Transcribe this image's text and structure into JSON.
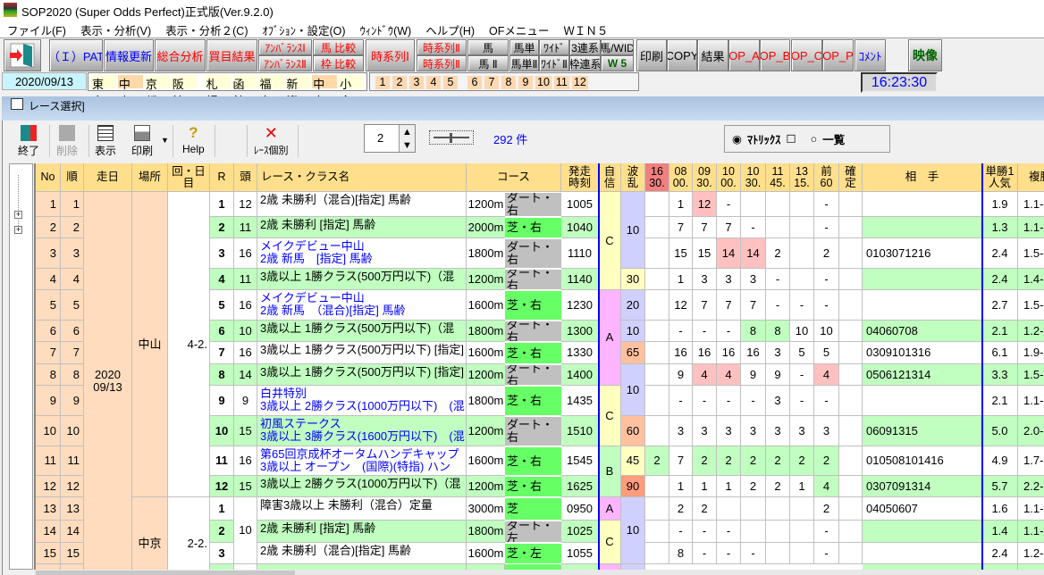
{
  "app": {
    "title": "SOP2020 (Super Odds Perfect)正式版(Ver.9.2.0)"
  },
  "menu": [
    "ファイル(F)",
    "表示・分析(V)",
    "表示・分析２(C)",
    "ｵﾌﾞｼｮﾝ・設定(O)",
    "ｳｨﾝﾄﾞｳ(W)",
    "ヘルプ(H)",
    "OFメニュー",
    "ＷＩＮ５"
  ],
  "toolbar": {
    "pat": "（Ｉ）PAT",
    "update": "情報更新",
    "analysis": "総合分析",
    "results": "買目結果",
    "unbalance1": "ｱﾝﾊﾞﾗﾝｽⅠ",
    "unbalance2": "ｱﾝﾊﾞﾗﾝｽⅡ",
    "horse_cmp": "馬 比較",
    "frame_cmp": "枠 比較",
    "timeseries1": "時系列Ⅰ",
    "timeseries2a": "時系列Ⅱ",
    "timeseries2b": "時系列Ⅱ",
    "horse": "馬",
    "horse2": "馬 Ⅱ",
    "umatan": "馬単",
    "umatan2": "馬単Ⅱ",
    "wide": "ﾜｲﾄﾞ",
    "wide2": "ﾜｲﾄﾞⅡ",
    "trio": "3連系",
    "wakuren": "枠連系",
    "horse_wid": "馬/WID",
    "win5": "W 5",
    "print": "印刷",
    "copy": "COPY",
    "result": "結果",
    "op_a": "OP_A",
    "op_b": "OP_B",
    "op_c": "OP_C",
    "op_p": "OP_P",
    "comment": "ｺﾒﾝﾄ",
    "video": "映像"
  },
  "date": "2020/09/13",
  "places": [
    {
      "name": "東京",
      "active": false
    },
    {
      "name": "中山",
      "active": true
    },
    {
      "name": "京都",
      "active": false
    },
    {
      "name": "阪神",
      "active": false
    },
    {
      "name": "札幌",
      "active": false
    },
    {
      "name": "函館",
      "active": false
    },
    {
      "name": "福島",
      "active": false
    },
    {
      "name": "新潟",
      "active": false
    },
    {
      "name": "中京",
      "active": true
    },
    {
      "name": "小倉",
      "active": false
    }
  ],
  "race_numbers": [
    "1",
    "2",
    "3",
    "4",
    "5",
    "6",
    "7",
    "8",
    "9",
    "10",
    "11",
    "12"
  ],
  "clock": "16:23:30",
  "child": {
    "title": "レース選択]",
    "tools": {
      "exit": "終了",
      "delete": "削除",
      "show": "表示",
      "print": "印刷",
      "help": "Help",
      "race_detail": "ﾚｰｽ個別"
    },
    "spinner_value": "2",
    "count": "292 件",
    "view_matrix": "ﾏﾄﾘｯｸｽ",
    "view_list": "一覧",
    "view_selected": "matrix"
  },
  "grid": {
    "headers": {
      "no": "No",
      "order": "順",
      "date": "走日",
      "place": "場所",
      "kai": "回・日\n目",
      "r": "R",
      "heads": "頭",
      "name": "レース・クラス名",
      "course": "コース",
      "post": "発走\n時刻",
      "jishin": "自\n信",
      "wave": "波\n乱",
      "times": [
        "16\n30.",
        "08\n00.",
        "09\n30.",
        "10\n00.",
        "10\n30.",
        "11\n45.",
        "13\n15.",
        "前\n60",
        "確\n定"
      ],
      "partner": "相　手",
      "win": "単勝1\n人気",
      "place_odds": "複勝"
    },
    "date_value": "2020\n09/13",
    "venues": [
      {
        "place": "中山",
        "kai": "4-2.",
        "rows": 12
      },
      {
        "place": "中京",
        "kai": "2-2.",
        "rows": 3
      }
    ],
    "heads_merged": [
      {
        "start": 13,
        "rows": 3,
        "value": "10"
      }
    ],
    "jishin_groups": [
      {
        "v": "C",
        "rows": 4,
        "color": "#ffffc0"
      },
      {
        "v": "A",
        "rows": 4,
        "color": "#ffb4ff"
      },
      {
        "v": "C",
        "rows": 2,
        "color": "#ffffc0"
      },
      {
        "v": "B",
        "rows": 2,
        "color": "#c0ffc0"
      },
      {
        "v": "A",
        "rows": 1,
        "color": "#ffb4ff"
      },
      {
        "v": "C",
        "rows": 2,
        "color": "#ffffc0"
      }
    ],
    "wave_groups": [
      {
        "v": "10",
        "rows": 3,
        "color": "#d0d0ff"
      },
      {
        "v": "30",
        "rows": 1,
        "color": "#ffffc0"
      },
      {
        "v": "20",
        "rows": 1,
        "color": "#d0d0ff"
      },
      {
        "v": "10",
        "rows": 1,
        "color": "#d0d0ff"
      },
      {
        "v": "65",
        "rows": 1,
        "color": "#ffc0a0"
      },
      {
        "v": "10",
        "rows": 2,
        "color": "#d0d0ff"
      },
      {
        "v": "60",
        "rows": 1,
        "color": "#ffc0a0"
      },
      {
        "v": "45",
        "rows": 1,
        "color": "#ffffc0"
      },
      {
        "v": "90",
        "rows": 1,
        "color": "#ff9c7c"
      },
      {
        "v": "10",
        "rows": 3,
        "color": "#d0d0ff"
      }
    ],
    "colors": {
      "dirt": "#c0c0c0",
      "turf": "#66ff66",
      "even_row": "#c0ffc0",
      "pink": "#ffc0c0",
      "green": "#c0ffc0",
      "info": "#ffdcbe",
      "header": "#ffdf8c",
      "named_race": "#0000ff"
    },
    "rows": [
      {
        "no": "1",
        "order": "1",
        "r": "1",
        "heads": "12",
        "name": "2歳 未勝利（混合)[指定] 馬齢",
        "named": false,
        "dist": "1200m",
        "surface": "ダート・右",
        "post": "1005",
        "times": [
          "",
          "1",
          "12p",
          "-",
          "",
          "",
          "",
          "-",
          ""
        ],
        "partner": "",
        "win": "1.9",
        "place": "1.1-"
      },
      {
        "no": "2",
        "order": "2",
        "r": "2",
        "heads": "11",
        "name": "2歳 未勝利 [指定] 馬齢",
        "named": false,
        "dist": "2000m",
        "surface": "芝・右",
        "post": "1040",
        "times": [
          "",
          "7",
          "7",
          "7",
          "-",
          "",
          "",
          "-",
          ""
        ],
        "partner": "",
        "win": "1.3",
        "place": "1.1-"
      },
      {
        "no": "3",
        "order": "3",
        "r": "3",
        "heads": "16",
        "name": "メイクデビュー中山\n2歳 新馬　[指定] 馬齢",
        "named": true,
        "dist": "1800m",
        "surface": "ダート・右",
        "post": "1110",
        "times": [
          "",
          "15",
          "15",
          "14p",
          "14p",
          "2",
          "",
          "2",
          ""
        ],
        "partner": "0103071216",
        "win": "2.4",
        "place": "1.5-"
      },
      {
        "no": "4",
        "order": "4",
        "r": "4",
        "heads": "11",
        "name": "3歳以上 1勝クラス(500万円以下)（混",
        "named": false,
        "dist": "1200m",
        "surface": "ダート・右",
        "post": "1140",
        "times": [
          "",
          "1",
          "3",
          "3",
          "3",
          "-",
          "",
          "-",
          ""
        ],
        "partner": "",
        "win": "2.4",
        "place": "1.4-"
      },
      {
        "no": "5",
        "order": "5",
        "r": "5",
        "heads": "16",
        "name": "メイクデビュー中山\n2歳 新馬　（混合)[指定] 馬齢",
        "named": true,
        "dist": "1600m",
        "surface": "芝・右",
        "post": "1230",
        "times": [
          "",
          "12",
          "7",
          "7",
          "7",
          "-",
          "-",
          "-",
          ""
        ],
        "partner": "",
        "win": "2.7",
        "place": "1.5-"
      },
      {
        "no": "6",
        "order": "6",
        "r": "6",
        "heads": "10",
        "name": "3歳以上 1勝クラス(500万円以下)（混",
        "named": false,
        "dist": "1800m",
        "surface": "ダート・右",
        "post": "1300",
        "times": [
          "",
          "-",
          "-",
          "-",
          "8g",
          "8g",
          "10",
          "10",
          ""
        ],
        "partner": "04060708",
        "win": "2.1",
        "place": "1.2-"
      },
      {
        "no": "7",
        "order": "7",
        "r": "7",
        "heads": "16",
        "name": "3歳以上 1勝クラス(500万円以下) [指定]",
        "named": false,
        "dist": "1600m",
        "surface": "芝・右",
        "post": "1330",
        "times": [
          "",
          "16",
          "16",
          "16",
          "16",
          "3",
          "5",
          "5",
          ""
        ],
        "partner": "0309101316",
        "win": "6.1",
        "place": "1.9-"
      },
      {
        "no": "8",
        "order": "8",
        "r": "8",
        "heads": "14",
        "name": "3歳以上 1勝クラス(500万円以下) [指定]",
        "named": false,
        "dist": "1200m",
        "surface": "ダート・右",
        "post": "1400",
        "times": [
          "",
          "9",
          "4p",
          "4p",
          "9",
          "9",
          "-",
          "4p",
          ""
        ],
        "partner": "0506121314",
        "win": "3.3",
        "place": "1.5-"
      },
      {
        "no": "9",
        "order": "9",
        "r": "9",
        "heads": "9",
        "name": "白井特別\n3歳以上 2勝クラス(1000万円以下)　(混",
        "named": true,
        "dist": "1800m",
        "surface": "芝・右",
        "post": "1435",
        "times": [
          "",
          "-",
          "-",
          "-",
          "-",
          "3",
          "-",
          "-",
          ""
        ],
        "partner": "",
        "win": "2.1",
        "place": "1.1-"
      },
      {
        "no": "10",
        "order": "10",
        "r": "10",
        "heads": "15",
        "name": "初風ステークス\n3歳以上 3勝クラス(1600万円以下)　(混",
        "named": true,
        "dist": "1200m",
        "surface": "ダート・右",
        "post": "1510",
        "times": [
          "",
          "3",
          "3",
          "3",
          "3",
          "3",
          "3",
          "3",
          ""
        ],
        "partner": "06091315",
        "win": "5.0",
        "place": "2.0-"
      },
      {
        "no": "11",
        "order": "11",
        "r": "11",
        "heads": "16",
        "name": "第65回京成杯オータムハンデキャップ\n3歳以上 オープン　(国際)(特指) ハン",
        "named": true,
        "dist": "1600m",
        "surface": "芝・右",
        "post": "1545",
        "times": [
          "2g",
          "7",
          "2g",
          "2g",
          "2g",
          "2g",
          "2g",
          "2g",
          ""
        ],
        "partner": "010508101416",
        "win": "4.9",
        "place": "1.7-"
      },
      {
        "no": "12",
        "order": "12",
        "r": "12",
        "heads": "15",
        "name": "3歳以上 2勝クラス(1000万円以下)（混",
        "named": false,
        "dist": "1200m",
        "surface": "芝・右",
        "post": "1625",
        "times": [
          "",
          "1",
          "1",
          "1",
          "2",
          "2",
          "1",
          "4g",
          ""
        ],
        "partner": "0307091314",
        "win": "5.7",
        "place": "2.2-"
      },
      {
        "no": "13",
        "order": "13",
        "r": "1",
        "heads": "",
        "name": "障害3歳以上 未勝利（混合）定量",
        "named": false,
        "dist": "3000m",
        "surface": "芝",
        "post": "0950",
        "times": [
          "",
          "2",
          "2",
          "",
          "",
          "",
          "",
          "2",
          ""
        ],
        "partner": "04050607",
        "win": "1.6",
        "place": "1.1-"
      },
      {
        "no": "14",
        "order": "14",
        "r": "2",
        "heads": "",
        "name": "2歳 未勝利 [指定] 馬齢",
        "named": false,
        "dist": "1800m",
        "surface": "ダート・左",
        "post": "1025",
        "times": [
          "",
          "-",
          "-",
          "-",
          "",
          "",
          "",
          "-",
          ""
        ],
        "partner": "",
        "win": "1.4",
        "place": "1.1-"
      },
      {
        "no": "15",
        "order": "15",
        "r": "3",
        "heads": "",
        "name": "2歳 未勝利（混合)[指定] 馬齢",
        "named": false,
        "dist": "1600m",
        "surface": "芝・左",
        "post": "1055",
        "times": [
          "",
          "8",
          "-",
          "-",
          "-",
          "",
          "",
          "-",
          ""
        ],
        "partner": "",
        "win": "2.4",
        "place": "1.2-"
      }
    ]
  }
}
